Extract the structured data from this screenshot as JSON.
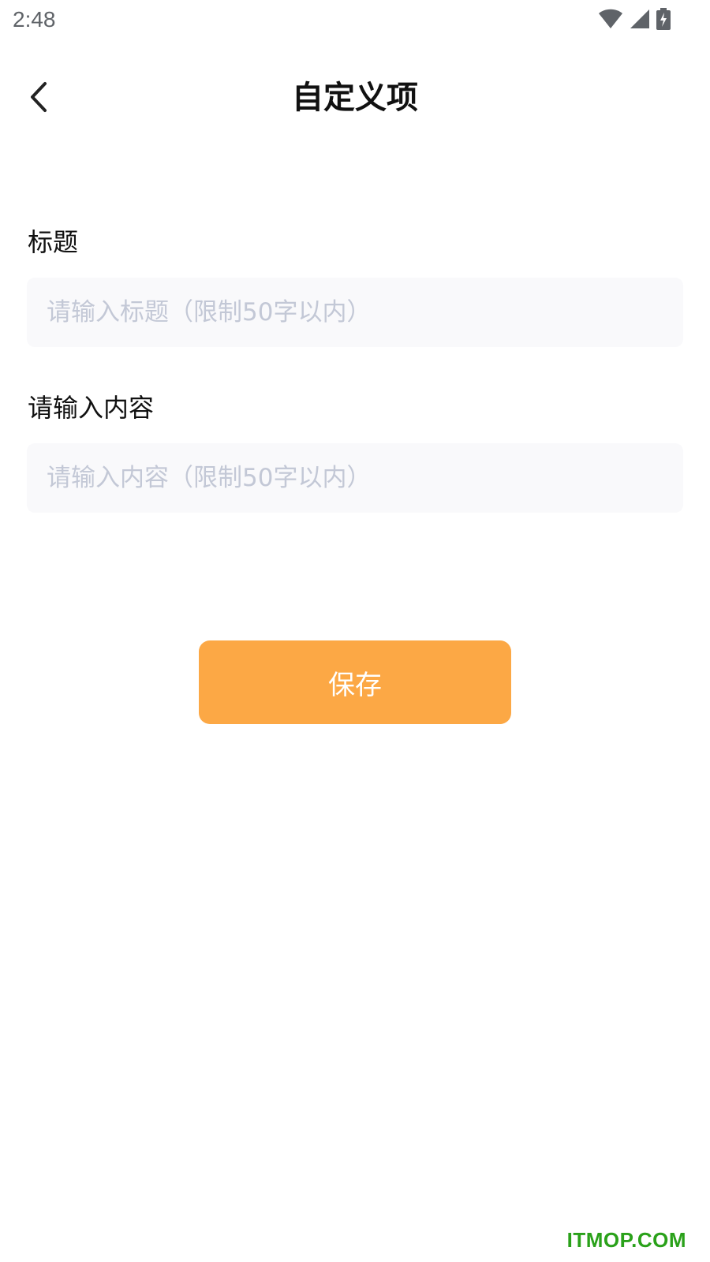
{
  "status_bar": {
    "time": "2:48",
    "icons": [
      "wifi-icon",
      "cellular-signal-icon",
      "battery-charging-icon"
    ],
    "icon_color": "#5f6368"
  },
  "nav": {
    "back_icon": "chevron-left-icon",
    "title": "自定义项"
  },
  "form": {
    "title_field": {
      "label": "标题",
      "value": "",
      "placeholder": "请输入标题（限制50字以内）"
    },
    "content_field": {
      "label": "请输入内容",
      "value": "",
      "placeholder": "请输入内容（限制50字以内）"
    }
  },
  "actions": {
    "save_label": "保存"
  },
  "watermark": {
    "text": "ITMOP.COM"
  },
  "colors": {
    "accent": "#fca845",
    "field_bg": "#f9f9fb",
    "placeholder": "#c3c8d6",
    "watermark": "#2aa11a"
  }
}
